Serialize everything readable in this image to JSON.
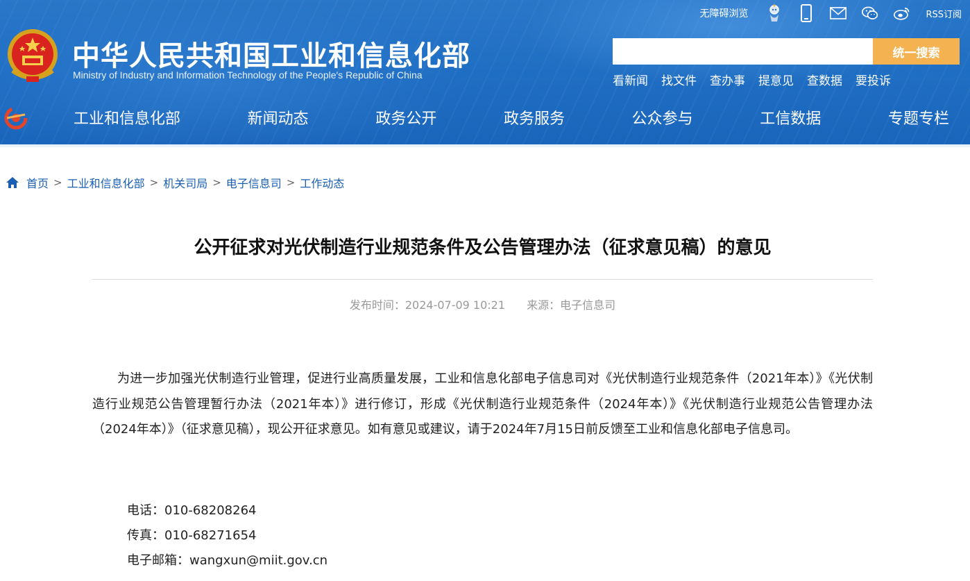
{
  "header": {
    "utility": {
      "accessibility_label": "无障碍浏览",
      "rss_label": "RSS订阅",
      "icons": [
        "robot-icon",
        "mobile-icon",
        "mail-icon",
        "wechat-icon",
        "weibo-icon"
      ]
    },
    "emblem": "national-emblem-icon",
    "title_cn": "中华人民共和国工业和信息化部",
    "title_en": "Ministry of Industry and Information Technology of the People's Republic of China",
    "search": {
      "placeholder": "",
      "button_label": "统一搜索"
    },
    "quick_links": [
      "看新闻",
      "找文件",
      "查办事",
      "提意见",
      "查数据",
      "要投诉"
    ],
    "nav": [
      "工业和信息化部",
      "新闻动态",
      "政务公开",
      "政务服务",
      "公众参与",
      "工信数据",
      "专题专栏"
    ],
    "colors": {
      "header_blue": "#1f6fc4",
      "search_button": "#f4b251",
      "link_blue": "#1a5fb4"
    }
  },
  "breadcrumb": [
    "首页",
    "工业和信息化部",
    "机关司局",
    "电子信息司",
    "工作动态"
  ],
  "article": {
    "title": "公开征求对光伏制造行业规范条件及公告管理办法（征求意见稿）的意见",
    "publish_label": "发布时间：",
    "publish_time": "2024-07-09 10:21",
    "source_label": "来源：",
    "source": "电子信息司",
    "body": "为进一步加强光伏制造行业管理，促进行业高质量发展，工业和信息化部电子信息司对《光伏制造行业规范条件（2021年本）》《光伏制造行业规范公告管理暂行办法（2021年本）》进行修订，形成《光伏制造行业规范条件（2024年本）》《光伏制造行业规范公告管理办法（2024年本）》（征求意见稿），现公开征求意见。如有意见或建议，请于2024年7月15日前反馈至工业和信息化部电子信息司。",
    "contacts": [
      {
        "label": "电话：",
        "value": "010-68208264"
      },
      {
        "label": "传真：",
        "value": "010-68271654"
      },
      {
        "label": "电子邮箱：",
        "value": "wangxun@miit.gov.cn"
      }
    ]
  }
}
